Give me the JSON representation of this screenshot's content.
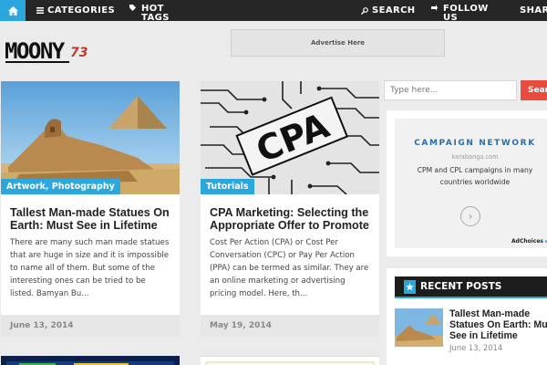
{
  "nav": {
    "categories": "CATEGORIES",
    "hot_tags": "HOT TAGS",
    "search": "SEARCH",
    "follow_us": "FOLLOW US",
    "share": "SHARE"
  },
  "header": {
    "logo_text": "MOONY73",
    "ad_banner": "Advertise Here"
  },
  "posts": [
    {
      "categories": "Artwork,  Photography",
      "title": "Tallest Man-made Statues On Earth: Must See in Lifetime",
      "excerpt": "There are many such man made statues that are huge in size and it is impossible to name all of them. But some of the interesting ones can be tried to be listed. Bamyan Bu...",
      "date": "June 13, 2014"
    },
    {
      "categories": "Tutorials",
      "title": "CPA Marketing: Selecting the Appropriate Offer to Promote",
      "excerpt": "Cost Per Action (CPA) or Cost Per Conversation (CPC) or Pay Per Action (PPA) can be termed as similar. They are an online marketing or advertising pricing model. Here, th...",
      "date": "May 19, 2014"
    }
  ],
  "sidebar": {
    "search_placeholder": "Type here...",
    "search_button": "Search",
    "ad": {
      "title": "CAMPAIGN NETWORK",
      "domain": "karabanga.com",
      "description": "CPM and CPL campaigns in many countries worldwide",
      "choices": "AdChoices"
    },
    "recent": {
      "heading": "RECENT POSTS",
      "title": "Tallest Man-made Statues On Earth: Must See in Lifetime",
      "date": "June 13, 2014"
    }
  },
  "colors": {
    "accent": "#2aa7dc",
    "nav_bg": "#262626",
    "search_button": "#e74c3c"
  }
}
